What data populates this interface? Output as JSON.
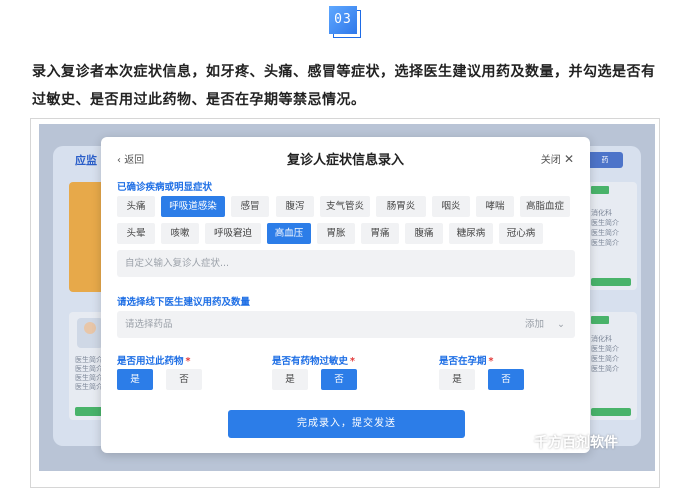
{
  "step_number": "03",
  "intro_text": "录入复诊者本次症状信息，如牙疼、头痛、感冒等症状，选择医生建议用药及数量，并勾选是否有过敏史、是否用过此药物、是否在孕期等禁忌情况。",
  "background": {
    "title": "应监",
    "right_badge": "药",
    "doctor_lines_left": [
      "医生简介",
      "医生简介",
      "医生简介",
      "医生简介"
    ],
    "doctor_right_1": [
      "消化科",
      "医生简介",
      "医生简介",
      "医生简介"
    ],
    "doctor_right_2": [
      "消化科",
      "医生简介",
      "医生简介",
      "医生简介"
    ]
  },
  "modal": {
    "back_label": "返回",
    "title": "复诊人症状信息录入",
    "close_label": "关闭",
    "symptoms_label": "已确诊疾病或明显症状",
    "symptoms": [
      {
        "label": "头痛",
        "selected": false
      },
      {
        "label": "呼吸道感染",
        "selected": true
      },
      {
        "label": "感冒",
        "selected": false
      },
      {
        "label": "腹泻",
        "selected": false
      },
      {
        "label": "支气管炎",
        "selected": false
      },
      {
        "label": "肠胃炎",
        "selected": false
      },
      {
        "label": "咽炎",
        "selected": false
      },
      {
        "label": "哮喘",
        "selected": false
      },
      {
        "label": "高脂血症",
        "selected": false
      },
      {
        "label": "头晕",
        "selected": false
      },
      {
        "label": "咳嗽",
        "selected": false
      },
      {
        "label": "呼吸窘迫",
        "selected": false
      },
      {
        "label": "高血压",
        "selected": true
      },
      {
        "label": "胃胀",
        "selected": false
      },
      {
        "label": "胃痛",
        "selected": false
      },
      {
        "label": "腹痛",
        "selected": false
      },
      {
        "label": "糖尿病",
        "selected": false
      },
      {
        "label": "冠心病",
        "selected": false
      }
    ],
    "custom_symptom_placeholder": "自定义输入复诊人症状...",
    "drug_label": "请选择线下医生建议用药及数量",
    "drug_placeholder": "请选择药品",
    "drug_add": "添加",
    "questions": [
      {
        "label": "是否用过此药物",
        "yes": "是",
        "no": "否",
        "selected": "yes"
      },
      {
        "label": "是否有药物过敏史",
        "yes": "是",
        "no": "否",
        "selected": "no"
      },
      {
        "label": "是否在孕期",
        "yes": "是",
        "no": "否",
        "selected": "no"
      }
    ],
    "submit_label": "完成录入，提交发送"
  },
  "watermark": "千方百剂软件",
  "colors": {
    "accent": "#2c7de8",
    "label_blue": "#1f6fe5",
    "required_star": "#e23a3a"
  }
}
